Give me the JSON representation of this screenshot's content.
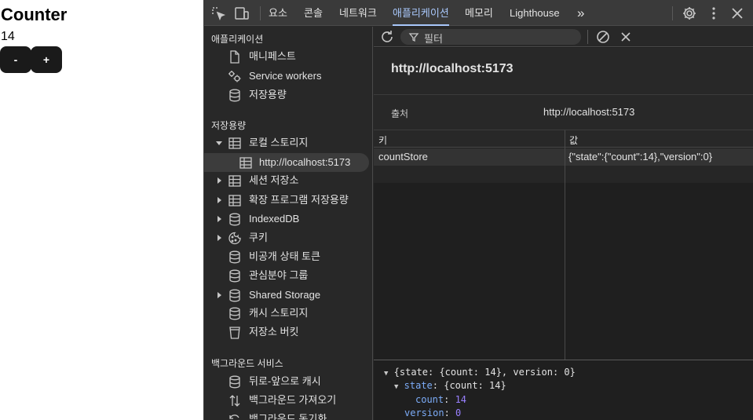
{
  "app": {
    "title": "Counter",
    "count": "14",
    "decrement_label": "-",
    "increment_label": "+"
  },
  "devtools": {
    "tabs": [
      {
        "label": "요소",
        "active": false
      },
      {
        "label": "콘솔",
        "active": false
      },
      {
        "label": "네트워크",
        "active": false
      },
      {
        "label": "애플리케이션",
        "active": true
      },
      {
        "label": "메모리",
        "active": false
      },
      {
        "label": "Lighthouse",
        "active": false
      }
    ],
    "more_tabs_label": "»",
    "sidebar": {
      "sections": [
        {
          "heading": "애플리케이션"
        },
        {
          "heading": "저장용량"
        },
        {
          "heading": "백그라운드 서비스"
        }
      ],
      "application_items": [
        {
          "label": "매니페스트",
          "icon": "document-icon"
        },
        {
          "label": "Service workers",
          "icon": "gears-icon"
        },
        {
          "label": "저장용량",
          "icon": "database-icon"
        }
      ],
      "storage_items": [
        {
          "label": "로컬 스토리지",
          "icon": "table-icon",
          "expanded": true
        },
        {
          "label": "http://localhost:5173",
          "icon": "table-icon",
          "selected": true
        },
        {
          "label": "세션 저장소",
          "icon": "table-icon",
          "expanded": false
        },
        {
          "label": "확장 프로그램 저장용량",
          "icon": "table-icon",
          "expanded": false
        },
        {
          "label": "IndexedDB",
          "icon": "database-icon",
          "expanded": false
        },
        {
          "label": "쿠키",
          "icon": "cookie-icon",
          "expanded": false
        },
        {
          "label": "비공개 상태 토큰",
          "icon": "database-icon"
        },
        {
          "label": "관심분야 그룹",
          "icon": "database-icon"
        },
        {
          "label": "Shared Storage",
          "icon": "database-icon",
          "expanded": false
        },
        {
          "label": "캐시 스토리지",
          "icon": "database-icon"
        },
        {
          "label": "저장소 버킷",
          "icon": "bucket-icon"
        }
      ],
      "background_items": [
        {
          "label": "뒤로-앞으로 캐시",
          "icon": "database-icon"
        },
        {
          "label": "백그라운드 가져오기",
          "icon": "arrows-updown-icon"
        },
        {
          "label": "백그라운드 동기화",
          "icon": "sync-icon"
        }
      ]
    },
    "toolbar": {
      "filter_placeholder": "필터"
    },
    "origin": {
      "title": "http://localhost:5173",
      "origin_key": "출처",
      "origin_value": "http://localhost:5173"
    },
    "table": {
      "columns": [
        "키",
        "값"
      ],
      "rows": [
        {
          "key": "countStore",
          "value": "{\"state\":{\"count\":14},\"version\":0}"
        }
      ]
    },
    "preview": {
      "root": "{state: {count: 14}, version: 0}",
      "state_key": "state",
      "state_value": "{count: 14}",
      "count_key": "count",
      "count_value": "14",
      "version_key": "version",
      "version_value": "0"
    }
  }
}
